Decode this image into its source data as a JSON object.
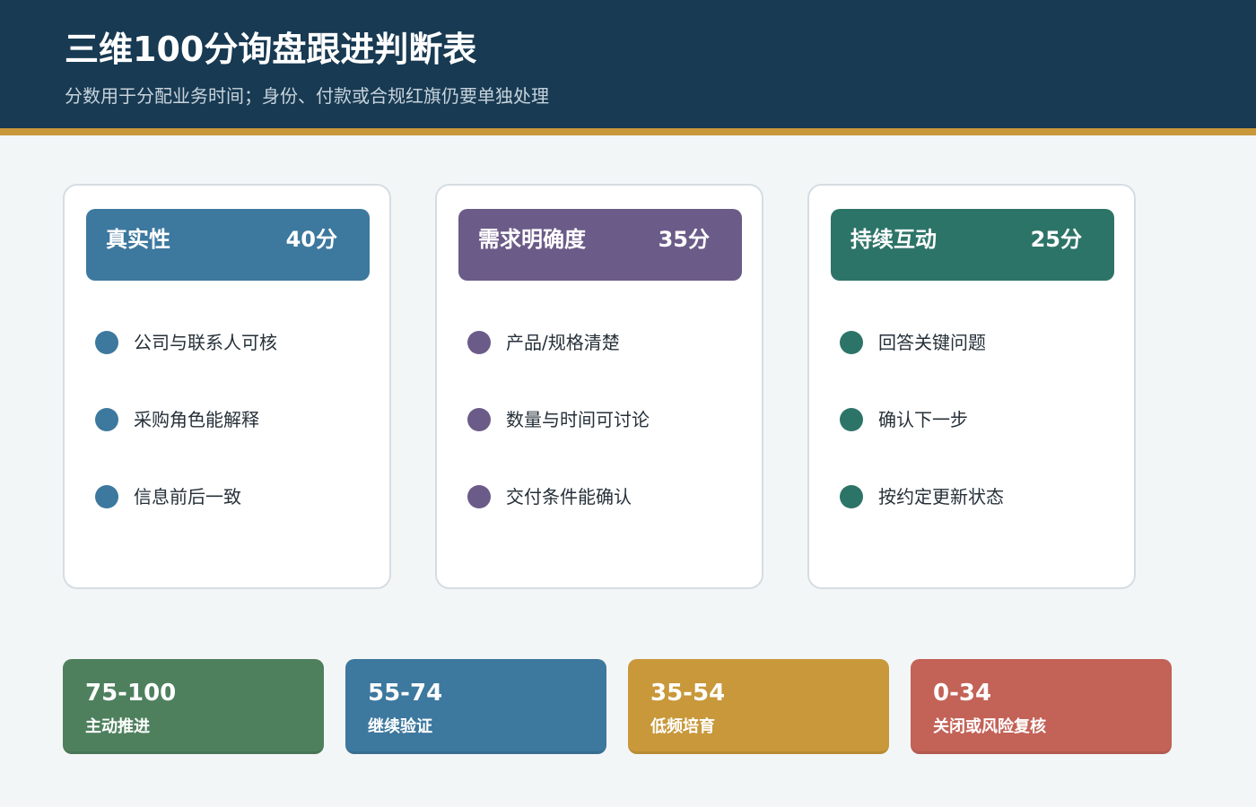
{
  "header": {
    "title": "三维100分询盘跟进判断表",
    "subtitle": "分数用于分配业务时间；身份、付款或合规红旗仍要单独处理"
  },
  "colors": {
    "header_bg": "#183a52",
    "accent_gold": "#c8983a",
    "page_bg": "#f3f6f7"
  },
  "dimensions": [
    {
      "name": "真实性",
      "score": "40分",
      "color": "#3d789e",
      "items": [
        "公司与联系人可核",
        "采购角色能解释",
        "信息前后一致"
      ]
    },
    {
      "name": "需求明确度",
      "score": "35分",
      "color": "#6b5b88",
      "items": [
        "产品/规格清楚",
        "数量与时间可讨论",
        "交付条件能确认"
      ]
    },
    {
      "name": "持续互动",
      "score": "25分",
      "color": "#2d7468",
      "items": [
        "回答关键问题",
        "确认下一步",
        "按约定更新状态"
      ]
    }
  ],
  "tiers": [
    {
      "range": "75-100",
      "label": "主动推进",
      "color": "#4f805e"
    },
    {
      "range": "55-74",
      "label": "继续验证",
      "color": "#3d789e"
    },
    {
      "range": "35-54",
      "label": "低频培育",
      "color": "#c8983a"
    },
    {
      "range": "0-34",
      "label": "关闭或风险复核",
      "color": "#c36257"
    }
  ]
}
